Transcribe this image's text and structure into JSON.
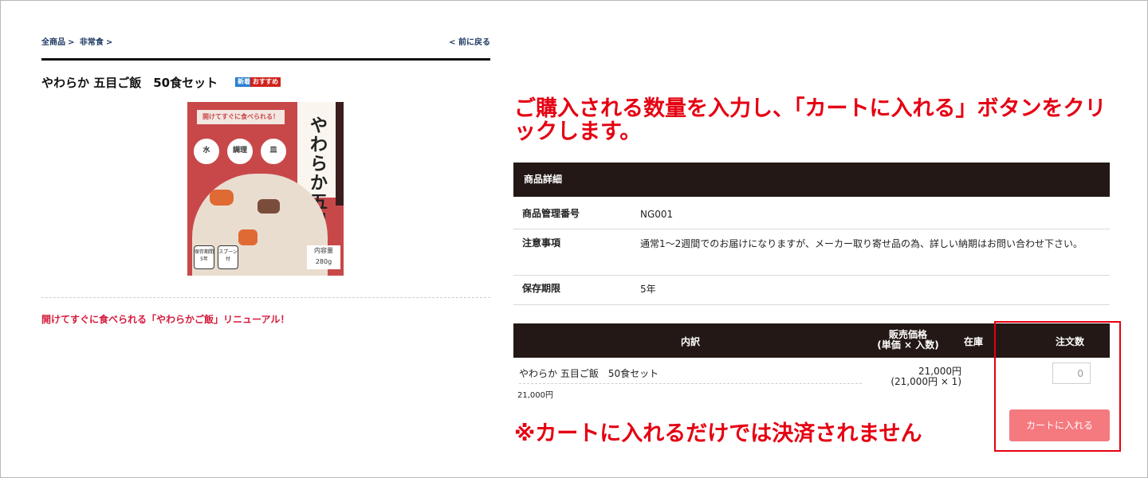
{
  "breadcrumb": {
    "all": "全商品",
    "sep1": ">",
    "category": "非常食",
    "sep2": ">"
  },
  "back_link": "< 前に戻る",
  "product": {
    "title": "やわらか 五目ご飯　50食セット",
    "badge_new": "新着",
    "badge_recommend": "おすすめ",
    "tagline": "開けてすぐに食べられる「やわらかご飯」リニューアル！"
  },
  "product_image": {
    "banner": "開けてすぐに食べられる！",
    "name": "やわらか五目ご飯",
    "circles": [
      "水",
      "調理",
      "皿"
    ],
    "icons": [
      "保存期間5年",
      "スプーン付"
    ],
    "weight_label": "内容量",
    "weight_value": "280g"
  },
  "instruction": "ご購入される数量を入力し、「カートに入れる」ボタンをクリックします。",
  "details": {
    "header": "商品詳細",
    "rows": [
      {
        "key": "商品管理番号",
        "value": "NG001"
      },
      {
        "key": "注意事項",
        "value": "通常1〜2週間でのお届けになりますが、メーカー取り寄せ品の為、詳しい納期はお問い合わせ下さい。"
      },
      {
        "key": "保存期限",
        "value": "5年"
      }
    ]
  },
  "order": {
    "col_breakdown": "内訳",
    "col_price_line1": "販売価格",
    "col_price_line2": "(単価 × 入数)",
    "col_stock": "在庫",
    "col_qty": "注文数",
    "item_name": "やわらか 五目ご飯　50食セット",
    "item_sub_price": "21,000円",
    "price_total": "21,000円",
    "price_breakdown": "(21,000円 × 1)",
    "qty_value": "0",
    "cart_button": "カートに入れる"
  },
  "note": "※カートに入れるだけでは決済されません",
  "colors": {
    "accent_red": "#e50012",
    "header_dark": "#231815",
    "cart_button": "#f47a80",
    "link_navy": "#1f3a63"
  }
}
